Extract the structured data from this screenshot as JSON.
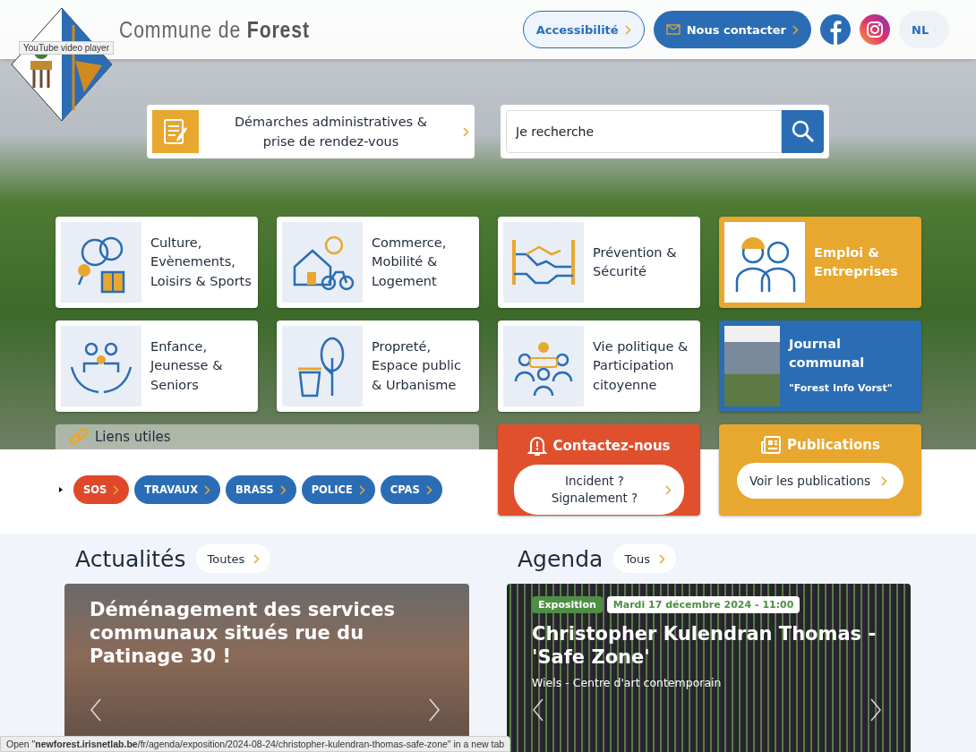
{
  "header": {
    "title": "Commune de **Forest**",
    "tooltip": "YouTube video player",
    "actions": [
      {
        "label": "Accessibilité",
        "kind": "outline"
      },
      {
        "label": "Nous contacter",
        "kind": "filled"
      }
    ],
    "language": "NL"
  },
  "admin_card": {
    "label": "Démarches administratives & prise de rendez-vous"
  },
  "search": {
    "placeholder": "Je recherche"
  },
  "tiles": [
    {
      "kind": "white",
      "label": "Culture, Evènements, Loisirs & Sports"
    },
    {
      "kind": "white",
      "label": "Commerce, Mobilité & Logement"
    },
    {
      "kind": "white",
      "label": "Prévention & Sécurité"
    },
    {
      "kind": "yellow",
      "label": "Emploi & Entreprises"
    },
    {
      "kind": "white",
      "label": "Enfance, Jeunesse & Seniors"
    },
    {
      "kind": "white",
      "label": "Propreté, Espace public & Urbanisme"
    },
    {
      "kind": "white",
      "label": "Vie politique & Participation citoyenne"
    },
    {
      "kind": "journal",
      "label": "Journal communal",
      "subtitle": "\"Forest Info Vorst\""
    }
  ],
  "useful_links": {
    "title": "Liens utiles",
    "links": [
      {
        "label": "SOS",
        "color": "#e0482a"
      },
      {
        "label": "TRAVAUX",
        "color": "#2a6db5"
      },
      {
        "label": "BRASS",
        "color": "#2a6db5"
      },
      {
        "label": "POLICE",
        "color": "#2a6db5"
      },
      {
        "label": "CPAS",
        "color": "#2a6db5"
      }
    ]
  },
  "contact": {
    "title": "Contactez-nous",
    "button": "Incident ? Signalement ?"
  },
  "publications": {
    "title": "Publications",
    "button": "Voir les publications"
  },
  "news": {
    "title": "Actualités",
    "all_link": "Toutes",
    "items": [
      {
        "title": "Déménagement des services communaux situés rue du Patinage 30 !"
      }
    ]
  },
  "agenda": {
    "title": "Agenda",
    "all_link": "Tous",
    "items": [
      {
        "category": "Exposition",
        "date": "Mardi 17 décembre 2024 - 11:00",
        "title": "Christopher Kulendran Thomas - 'Safe Zone'",
        "location": "Wiels - Centre d'art contemporain"
      }
    ]
  },
  "status_bar": "Open \"**newforest.irisnetlab.be**/fr/agenda/exposition/2024-08-24/christopher-kulendran-thomas-safe-zone\" in a new tab"
}
